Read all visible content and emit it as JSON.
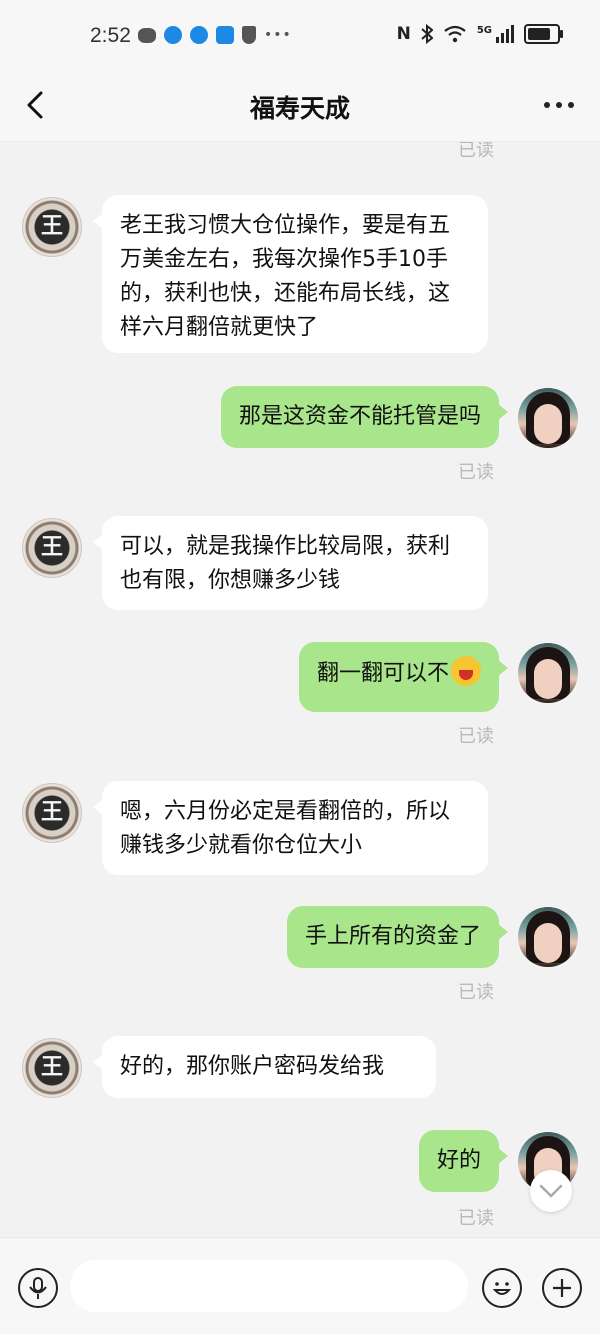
{
  "status_bar": {
    "time": "2:52",
    "network": "5G",
    "left_icons": [
      "wechat-icon",
      "browser-icon",
      "browser-icon",
      "signal-app-icon",
      "shield-icon",
      "more-icon"
    ],
    "right_icons": [
      "nfc-icon",
      "bluetooth-icon",
      "wifi-icon",
      "cell-signal-icon",
      "battery-icon"
    ]
  },
  "header": {
    "title": "福寿天成",
    "back_icon": "chevron-left-icon",
    "more_icon": "more-dots-icon"
  },
  "chat": {
    "read_label": "已读",
    "messages": [
      {
        "side": "left",
        "text": "老王我习惯大仓位操作，要是有五万美金左右，我每次操作5手10手的，获利也快，还能布局长线，这样六月翻倍就更快了"
      },
      {
        "side": "right",
        "text": "那是这资金不能托管是吗",
        "read": "已读"
      },
      {
        "side": "left",
        "text": "可以，就是我操作比较局限，获利也有限，你想赚多少钱"
      },
      {
        "side": "right",
        "text": "翻一翻可以不",
        "emoji": "laughing-face-emoji",
        "read": "已读"
      },
      {
        "side": "left",
        "text": "嗯，六月份必定是看翻倍的，所以赚钱多少就看你仓位大小"
      },
      {
        "side": "right",
        "text": "手上所有的资金了",
        "read": "已读"
      },
      {
        "side": "left",
        "text": "好的，那你账户密码发给我"
      },
      {
        "side": "right",
        "text": "好的",
        "read": "已读"
      }
    ],
    "left_avatar_text": "王",
    "colors": {
      "background": "#f2f2f2",
      "incoming_bubble": "#ffffff",
      "outgoing_bubble": "#a9e58a",
      "read_label": "#b8b8b8"
    }
  },
  "input_bar": {
    "voice_icon": "microphone-icon",
    "emoji_icon": "smiley-icon",
    "add_icon": "plus-icon",
    "placeholder": ""
  }
}
